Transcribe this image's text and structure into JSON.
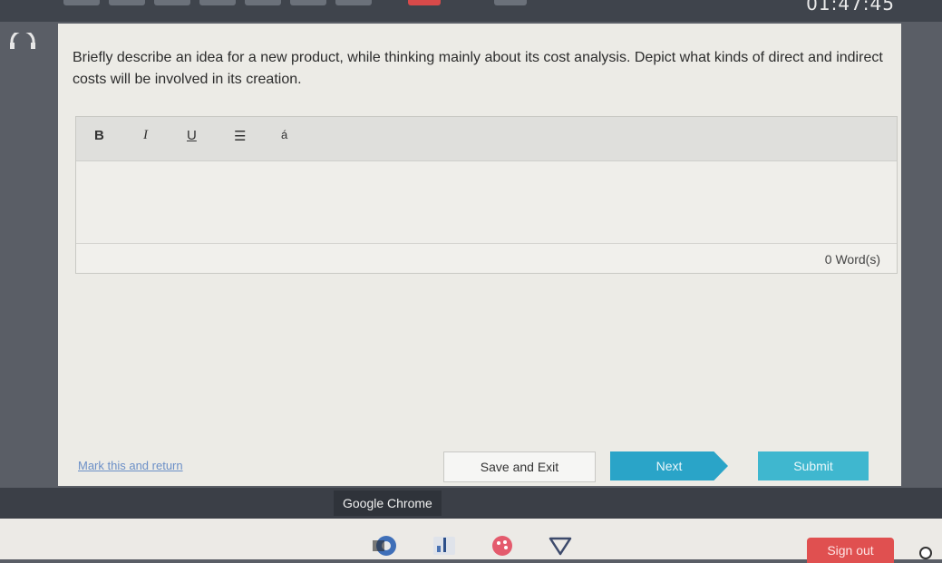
{
  "header": {
    "timer": "01:47:45"
  },
  "question": {
    "text": "Briefly describe an idea for a new product, while thinking mainly about its cost analysis. Depict what kinds of direct and indirect costs will be involved in its creation."
  },
  "editor": {
    "toolbar": {
      "bold": "B",
      "italic": "I",
      "underline": "U",
      "list": "☰",
      "special_char": "á"
    },
    "value": "",
    "word_count": "0 Word(s)"
  },
  "actions": {
    "mark_return": "Mark this and return",
    "save_exit": "Save and Exit",
    "next": "Next",
    "submit": "Submit"
  },
  "taskbar": {
    "chrome_label": "Google Chrome",
    "sign_out": "Sign out"
  },
  "colors": {
    "next": "#2aa4c8",
    "submit": "#3fb7cf",
    "sign_out": "#e05050"
  }
}
